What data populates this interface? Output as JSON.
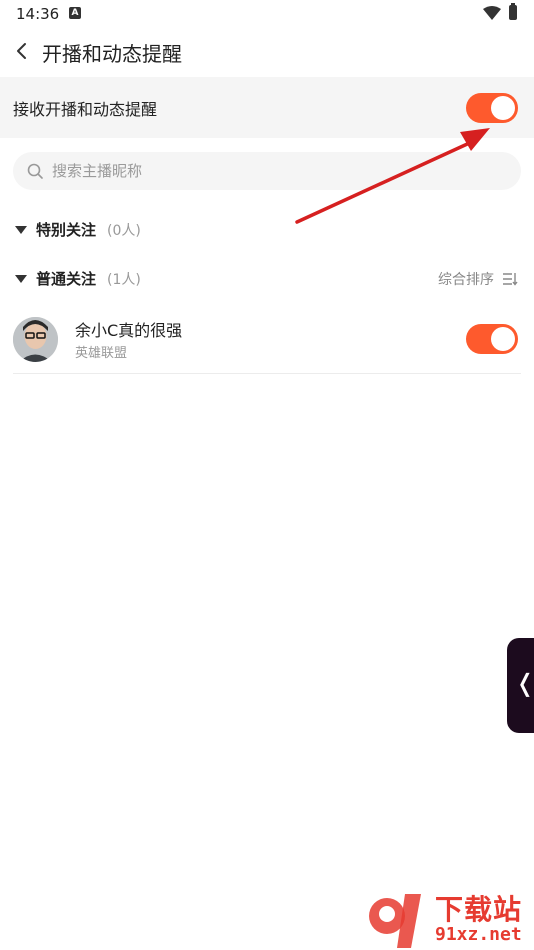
{
  "status_bar": {
    "time": "14:36",
    "a_label": "A"
  },
  "header": {
    "title": "开播和动态提醒"
  },
  "master_setting": {
    "label": "接收开播和动态提醒",
    "enabled": true
  },
  "search": {
    "placeholder": "搜索主播昵称"
  },
  "groups": [
    {
      "title": "特别关注",
      "count": "(0人)"
    },
    {
      "title": "普通关注",
      "count": "(1人)",
      "sort_label": "综合排序"
    }
  ],
  "follows": [
    {
      "name": "余小C真的很强",
      "game": "英雄联盟",
      "notify": true
    }
  ],
  "watermark": {
    "title": "下载站",
    "url": "91xz.net"
  },
  "colors": {
    "accent": "#fe5a2d",
    "arrow": "#d62020"
  }
}
